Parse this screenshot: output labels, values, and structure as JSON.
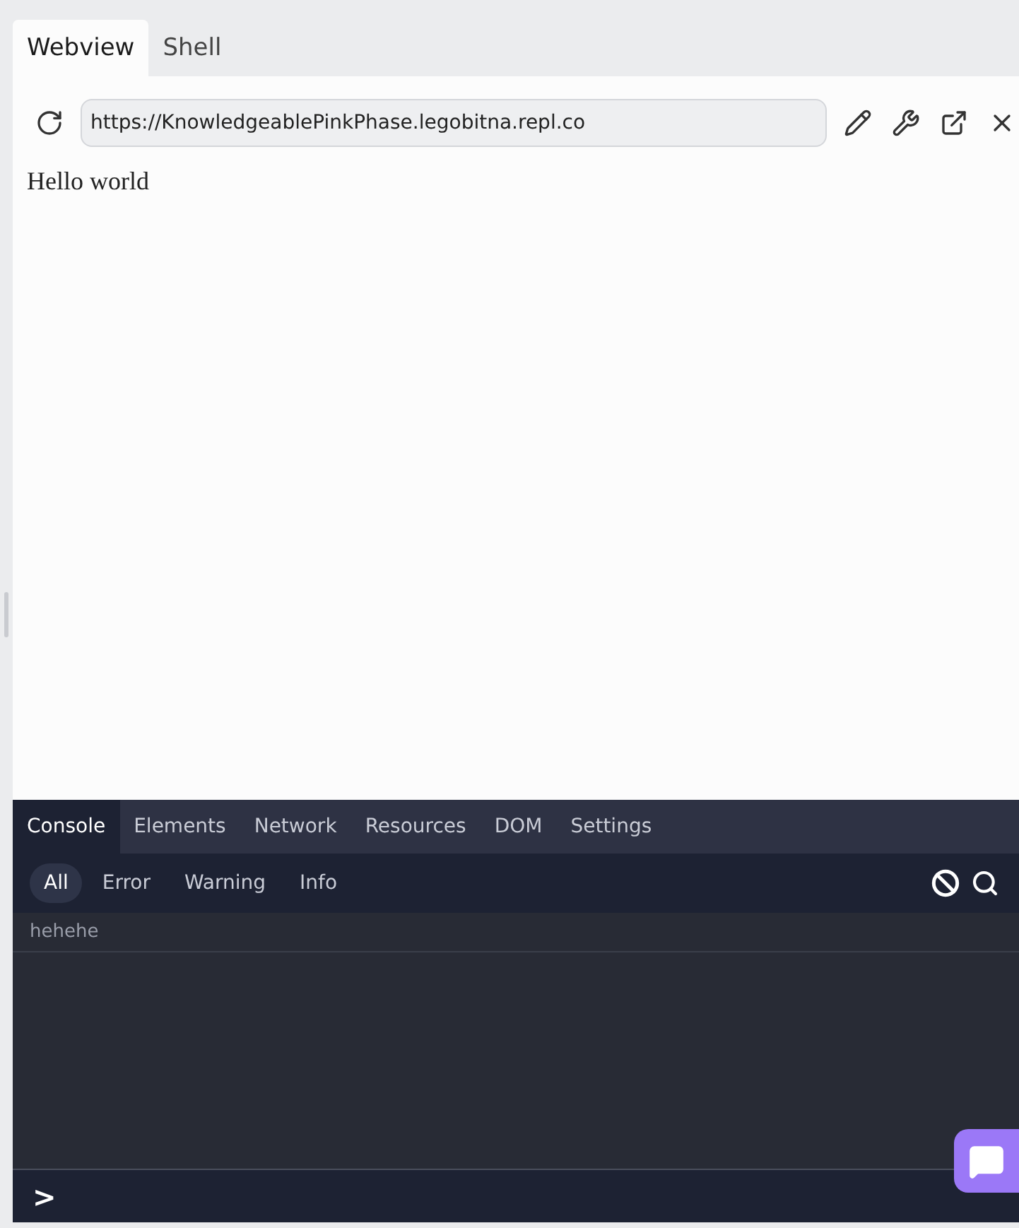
{
  "tabs": [
    {
      "label": "Webview",
      "selected": true
    },
    {
      "label": "Shell",
      "selected": false
    }
  ],
  "address_bar": {
    "value": "https://KnowledgeablePinkPhase.legobitna.repl.co"
  },
  "page_content": {
    "text": "Hello world"
  },
  "devtools": {
    "tabs": [
      {
        "label": "Console",
        "selected": true
      },
      {
        "label": "Elements",
        "selected": false
      },
      {
        "label": "Network",
        "selected": false
      },
      {
        "label": "Resources",
        "selected": false
      },
      {
        "label": "DOM",
        "selected": false
      },
      {
        "label": "Settings",
        "selected": false
      }
    ],
    "filters": [
      {
        "label": "All",
        "selected": true
      },
      {
        "label": "Error",
        "selected": false
      },
      {
        "label": "Warning",
        "selected": false
      },
      {
        "label": "Info",
        "selected": false
      }
    ],
    "log_lines": [
      "hehehe"
    ],
    "prompt": ">"
  }
}
